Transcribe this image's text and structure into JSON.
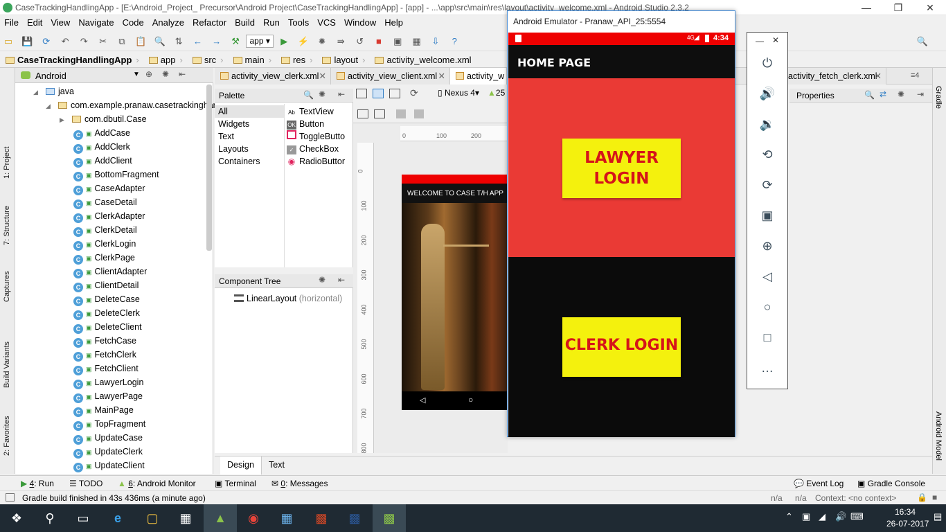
{
  "window": {
    "title": "CaseTrackingHandlingApp - [E:\\Android_Project_ Precursor\\Android Project\\CaseTrackingHandlingApp] - [app] - ...\\app\\src\\main\\res\\layout\\activity_welcome.xml - Android Studio 2.3.2",
    "min_icon": "minimize-icon",
    "max_icon": "maximize-icon",
    "close_icon": "close-icon"
  },
  "menu": [
    "File",
    "Edit",
    "View",
    "Navigate",
    "Code",
    "Analyze",
    "Refactor",
    "Build",
    "Run",
    "Tools",
    "VCS",
    "Window",
    "Help"
  ],
  "toolbar": {
    "run_config": "app"
  },
  "breadcrumbs": [
    "CaseTrackingHandlingApp",
    "app",
    "src",
    "main",
    "res",
    "layout",
    "activity_welcome.xml"
  ],
  "left_strip": [
    "1: Project",
    "7: Structure",
    "Captures",
    "Build Variants",
    "2: Favorites"
  ],
  "project": {
    "view_mode": "Android",
    "tree": [
      {
        "label": "java",
        "type": "folder",
        "indent": 0
      },
      {
        "label": "com.example.pranaw.casetrackinghand",
        "type": "package",
        "indent": 1
      },
      {
        "label": "com.dbutil.Case",
        "type": "package",
        "indent": 2
      },
      {
        "label": "AddCase",
        "type": "class",
        "indent": 3
      },
      {
        "label": "AddClerk",
        "type": "class",
        "indent": 3
      },
      {
        "label": "AddClient",
        "type": "class",
        "indent": 3
      },
      {
        "label": "BottomFragment",
        "type": "class",
        "indent": 3
      },
      {
        "label": "CaseAdapter",
        "type": "class",
        "indent": 3
      },
      {
        "label": "CaseDetail",
        "type": "class",
        "indent": 3
      },
      {
        "label": "ClerkAdapter",
        "type": "class",
        "indent": 3
      },
      {
        "label": "ClerkDetail",
        "type": "class",
        "indent": 3
      },
      {
        "label": "ClerkLogin",
        "type": "class",
        "indent": 3
      },
      {
        "label": "ClerkPage",
        "type": "class",
        "indent": 3
      },
      {
        "label": "ClientAdapter",
        "type": "class",
        "indent": 3
      },
      {
        "label": "ClientDetail",
        "type": "class",
        "indent": 3
      },
      {
        "label": "DeleteCase",
        "type": "class",
        "indent": 3
      },
      {
        "label": "DeleteClerk",
        "type": "class",
        "indent": 3
      },
      {
        "label": "DeleteClient",
        "type": "class",
        "indent": 3
      },
      {
        "label": "FetchCase",
        "type": "class",
        "indent": 3
      },
      {
        "label": "FetchClerk",
        "type": "class",
        "indent": 3
      },
      {
        "label": "FetchClient",
        "type": "class",
        "indent": 3
      },
      {
        "label": "LawyerLogin",
        "type": "class",
        "indent": 3
      },
      {
        "label": "LawyerPage",
        "type": "class",
        "indent": 3
      },
      {
        "label": "MainPage",
        "type": "class",
        "indent": 3
      },
      {
        "label": "TopFragment",
        "type": "class",
        "indent": 3
      },
      {
        "label": "UpdateCase",
        "type": "class",
        "indent": 3
      },
      {
        "label": "UpdateClerk",
        "type": "class",
        "indent": 3
      },
      {
        "label": "UpdateClient",
        "type": "class",
        "indent": 3
      }
    ]
  },
  "editor_tabs": [
    "activity_view_clerk.xml",
    "activity_view_client.xml",
    "activity_w",
    "activity_fetch_clerk.xml"
  ],
  "palette": {
    "title": "Palette",
    "categories": [
      "All",
      "Widgets",
      "Text",
      "Layouts",
      "Containers"
    ],
    "widgets": [
      {
        "icon": "Ab",
        "label": "TextView"
      },
      {
        "icon": "OK",
        "label": "Button"
      },
      {
        "icon": "",
        "label": "ToggleButto"
      },
      {
        "icon": "✓",
        "label": "CheckBox"
      },
      {
        "icon": "◉",
        "label": "RadioButtor"
      }
    ]
  },
  "component_tree": {
    "title": "Component Tree",
    "root": "LinearLayout",
    "root_hint": "(horizontal)"
  },
  "design_toolbar": {
    "device": "Nexus 4",
    "api": "25"
  },
  "rulers": {
    "h": [
      "0",
      "100",
      "200"
    ],
    "v": [
      "0",
      "100",
      "200",
      "300",
      "400",
      "500",
      "600",
      "700",
      "800"
    ]
  },
  "preview": {
    "header": "WELCOME TO CASE T/H APP"
  },
  "design_tabs": [
    "Design",
    "Text"
  ],
  "properties": {
    "title": "Properties"
  },
  "right_strip": [
    "Gradle",
    "Android Model"
  ],
  "emulator": {
    "title": "Android Emulator - Pranaw_API_25:5554",
    "status_time": "4:34",
    "status_net": "4G",
    "app_title": "HOME PAGE",
    "lawyer_button": "LAWYER\nLOGIN",
    "clerk_button": "CLERK LOGIN",
    "accent_red": "#ea3a35",
    "button_yellow": "#f4f10d",
    "button_text_red": "#d5141a"
  },
  "emulator_controls": [
    "power-icon",
    "volume-up-icon",
    "volume-down-icon",
    "rotate-left-icon",
    "rotate-right-icon",
    "camera-icon",
    "zoom-icon",
    "back-icon",
    "home-icon",
    "overview-icon",
    "more-icon"
  ],
  "tool_windows": {
    "left": [
      {
        "key": "4",
        "label": ": Run"
      },
      {
        "key": "",
        "label": "TODO"
      },
      {
        "key": "6",
        "label": ": Android Monitor"
      },
      {
        "key": "",
        "label": "Terminal"
      },
      {
        "key": "0",
        "label": ": Messages"
      }
    ],
    "right": [
      "Event Log",
      "Gradle Console"
    ]
  },
  "status": {
    "message": "Gradle build finished in 43s 436ms (a minute ago)",
    "na1": "n/a",
    "na2": "n/a",
    "context": "Context: <no context>"
  },
  "taskbar": {
    "time": "16:34",
    "date": "26-07-2017"
  }
}
